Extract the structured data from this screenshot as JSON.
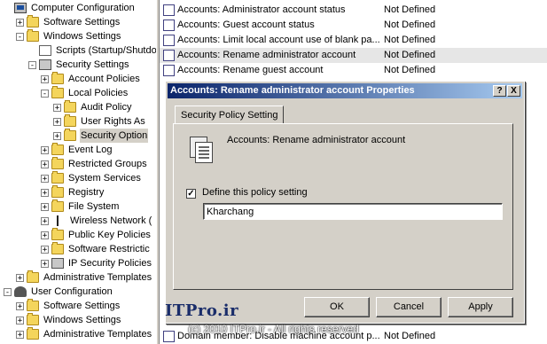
{
  "tree": {
    "items": [
      {
        "label": "Computer Configuration",
        "indent": 0,
        "icon": "computer-icon",
        "exp": "none"
      },
      {
        "label": "Software Settings",
        "indent": 1,
        "icon": "folder-icon",
        "exp": "+"
      },
      {
        "label": "Windows Settings",
        "indent": 1,
        "icon": "folder-icon",
        "exp": "-"
      },
      {
        "label": "Scripts (Startup/Shutdo",
        "indent": 2,
        "icon": "doc-icon",
        "exp": "none"
      },
      {
        "label": "Security Settings",
        "indent": 2,
        "icon": "shield-icon",
        "exp": "-"
      },
      {
        "label": "Account Policies",
        "indent": 3,
        "icon": "folder-icon",
        "exp": "+"
      },
      {
        "label": "Local Policies",
        "indent": 3,
        "icon": "folder-icon",
        "exp": "-"
      },
      {
        "label": "Audit Policy",
        "indent": 4,
        "icon": "folder-icon",
        "exp": "+"
      },
      {
        "label": "User Rights As",
        "indent": 4,
        "icon": "folder-icon",
        "exp": "+"
      },
      {
        "label": "Security Option",
        "indent": 4,
        "icon": "folder-icon",
        "exp": "+",
        "selected": true
      },
      {
        "label": "Event Log",
        "indent": 3,
        "icon": "folder-icon",
        "exp": "+"
      },
      {
        "label": "Restricted Groups",
        "indent": 3,
        "icon": "folder-icon",
        "exp": "+"
      },
      {
        "label": "System Services",
        "indent": 3,
        "icon": "folder-icon",
        "exp": "+"
      },
      {
        "label": "Registry",
        "indent": 3,
        "icon": "folder-icon",
        "exp": "+"
      },
      {
        "label": "File System",
        "indent": 3,
        "icon": "folder-icon",
        "exp": "+"
      },
      {
        "label": "Wireless Network (",
        "indent": 3,
        "icon": "antenna-icon",
        "exp": "+"
      },
      {
        "label": "Public Key Policies",
        "indent": 3,
        "icon": "folder-icon",
        "exp": "+"
      },
      {
        "label": "Software Restrictic",
        "indent": 3,
        "icon": "folder-icon",
        "exp": "+"
      },
      {
        "label": "IP Security Policies",
        "indent": 3,
        "icon": "shield-icon",
        "exp": "+"
      },
      {
        "label": "Administrative Templates",
        "indent": 1,
        "icon": "folder-icon",
        "exp": "+"
      },
      {
        "label": "User Configuration",
        "indent": 0,
        "icon": "user-icon",
        "exp": "-"
      },
      {
        "label": "Software Settings",
        "indent": 1,
        "icon": "folder-icon",
        "exp": "+"
      },
      {
        "label": "Windows Settings",
        "indent": 1,
        "icon": "folder-icon",
        "exp": "+"
      },
      {
        "label": "Administrative Templates",
        "indent": 1,
        "icon": "folder-icon",
        "exp": "+"
      }
    ]
  },
  "policies": [
    {
      "name": "Accounts: Administrator account status",
      "value": "Not Defined"
    },
    {
      "name": "Accounts: Guest account status",
      "value": "Not Defined"
    },
    {
      "name": "Accounts: Limit local account use of blank pa...",
      "value": "Not Defined"
    },
    {
      "name": "Accounts: Rename administrator account",
      "value": "Not Defined",
      "highlight": true
    },
    {
      "name": "Accounts: Rename guest account",
      "value": "Not Defined"
    },
    {
      "name": "Domain member: Disable machine account p...",
      "value": "Not Defined"
    }
  ],
  "dialog": {
    "title": "Accounts: Rename administrator account Properties",
    "help_btn": "?",
    "close_btn": "X",
    "tab_label": "Security Policy Setting",
    "policy_name": "Accounts: Rename administrator account",
    "define_label": "Define this policy setting",
    "define_checked": "✓",
    "value": "Kharchang",
    "ok_label": "OK",
    "cancel_label": "Cancel",
    "apply_label": "Apply"
  },
  "watermark": {
    "brand": "ITPro.ir",
    "footer": "(c) 2010 ITPro.ir - All rights reserved"
  }
}
